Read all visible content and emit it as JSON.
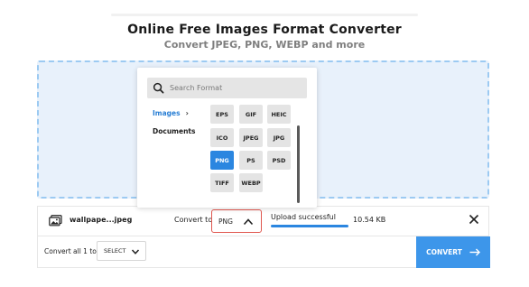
{
  "header": {
    "title": "Online Free Images Format Converter",
    "subtitle": "Convert JPEG, PNG, WEBP and more"
  },
  "format_picker": {
    "search_placeholder": "Search Format",
    "categories": [
      {
        "label": "Images",
        "active": true
      },
      {
        "label": "Documents",
        "active": false
      }
    ],
    "formats": [
      {
        "label": "EPS",
        "selected": false
      },
      {
        "label": "GIF",
        "selected": false
      },
      {
        "label": "HEIC",
        "selected": false
      },
      {
        "label": "ICO",
        "selected": false
      },
      {
        "label": "JPEG",
        "selected": false
      },
      {
        "label": "JPG",
        "selected": false
      },
      {
        "label": "PNG",
        "selected": true
      },
      {
        "label": "PS",
        "selected": false
      },
      {
        "label": "PSD",
        "selected": false
      },
      {
        "label": "TIFF",
        "selected": false
      },
      {
        "label": "WEBP",
        "selected": false
      }
    ]
  },
  "file": {
    "name": "wallpape...jpeg",
    "convert_to_label": "Convert to",
    "target_format": "PNG",
    "status": "Upload successful",
    "progress": 1.0,
    "size": "10.54 KB"
  },
  "footer": {
    "convert_all_label": "Convert all 1 to",
    "bulk_select_value": "SELECT",
    "convert_button_label": "CONVERT"
  },
  "colors": {
    "accent": "#2b86e0",
    "dropzone_bg": "#e8f1fb",
    "dropzone_border": "#9ccaf2",
    "highlight_border": "#e0574f"
  }
}
